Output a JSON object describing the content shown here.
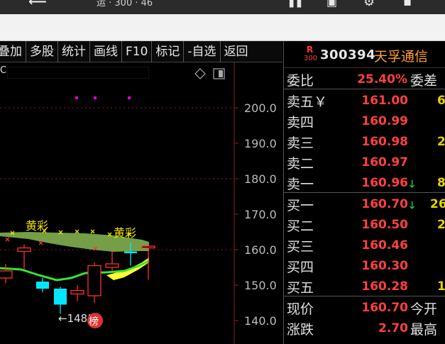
{
  "titlebar": {
    "back_glyph": "⟵",
    "title_partial": "运 · 300 · 46",
    "icon1": "▌▌",
    "icon2": "▣",
    "icon3": "⚙",
    "icon4": "▪"
  },
  "toolbar": {
    "items": [
      "叠加",
      "多股",
      "统计",
      "画线",
      "F10",
      "标记",
      "-自选",
      "返回"
    ]
  },
  "chart": {
    "letter": "C",
    "label_huangcai_1": "黄彩",
    "label_huangcai_2": "黄彩",
    "low_label": "←14814",
    "rank_badge": "榜",
    "y_ticks": [
      "200.0",
      "190.0",
      "180.0",
      "170.0",
      "160.0",
      "150.0",
      "140.0"
    ]
  },
  "chart_data": {
    "type": "candlestick",
    "ylim": [
      136,
      208
    ],
    "y_ticks": [
      200,
      190,
      180,
      170,
      160,
      150,
      140
    ],
    "candles": [
      {
        "open": 154.0,
        "close": 152.0,
        "high": 156.0,
        "low": 150.5,
        "color": "red"
      },
      {
        "open": 159.5,
        "close": 160.5,
        "high": 161.5,
        "low": 154.5,
        "color": "red"
      },
      {
        "open": 151.0,
        "close": 149.0,
        "high": 152.0,
        "low": 148.0,
        "color": "cyan"
      },
      {
        "open": 149.0,
        "close": 144.5,
        "high": 149.5,
        "low": 142.0,
        "color": "cyan"
      },
      {
        "open": 147.5,
        "close": 148.5,
        "high": 150.0,
        "low": 145.5,
        "color": "red"
      },
      {
        "open": 147.0,
        "close": 155.5,
        "high": 156.5,
        "low": 145.0,
        "color": "red"
      },
      {
        "open": 155.0,
        "close": 156.0,
        "high": 159.5,
        "low": 154.0,
        "color": "red"
      },
      {
        "open": 159.0,
        "close": 159.5,
        "high": 162.0,
        "low": 155.5,
        "color": "cyan"
      },
      {
        "open": 160.5,
        "close": 161.0,
        "high": 161.5,
        "low": 151.5,
        "color": "red"
      }
    ]
  },
  "panel": {
    "badge_r": "R",
    "badge_num": "300",
    "code": "300394",
    "name": "天孚通信",
    "weibi_label": "委比",
    "weibi_value": "25.40%",
    "weicha_label": "委差",
    "asks": [
      {
        "label": "卖五￥",
        "price": "161.00",
        "vol": "6"
      },
      {
        "label": "卖四",
        "price": "160.99",
        "vol": ""
      },
      {
        "label": "卖三",
        "price": "160.98",
        "vol": "2"
      },
      {
        "label": "卖二",
        "price": "160.97",
        "vol": ""
      },
      {
        "label": "卖一",
        "price": "160.96",
        "vol": "8"
      }
    ],
    "bids": [
      {
        "label": "买一",
        "price": "160.70",
        "vol": "26"
      },
      {
        "label": "买二",
        "price": "160.50",
        "vol": "2"
      },
      {
        "label": "买三",
        "price": "160.46",
        "vol": ""
      },
      {
        "label": "买四",
        "price": "160.30",
        "vol": ""
      },
      {
        "label": "买五",
        "price": "160.28",
        "vol": "1"
      }
    ],
    "current_label": "现价",
    "current_value": "160.70",
    "open_label": "今开",
    "change_label": "涨跌",
    "change_value": "2.70",
    "high_label": "最高",
    "down_arrow": "🡓"
  }
}
